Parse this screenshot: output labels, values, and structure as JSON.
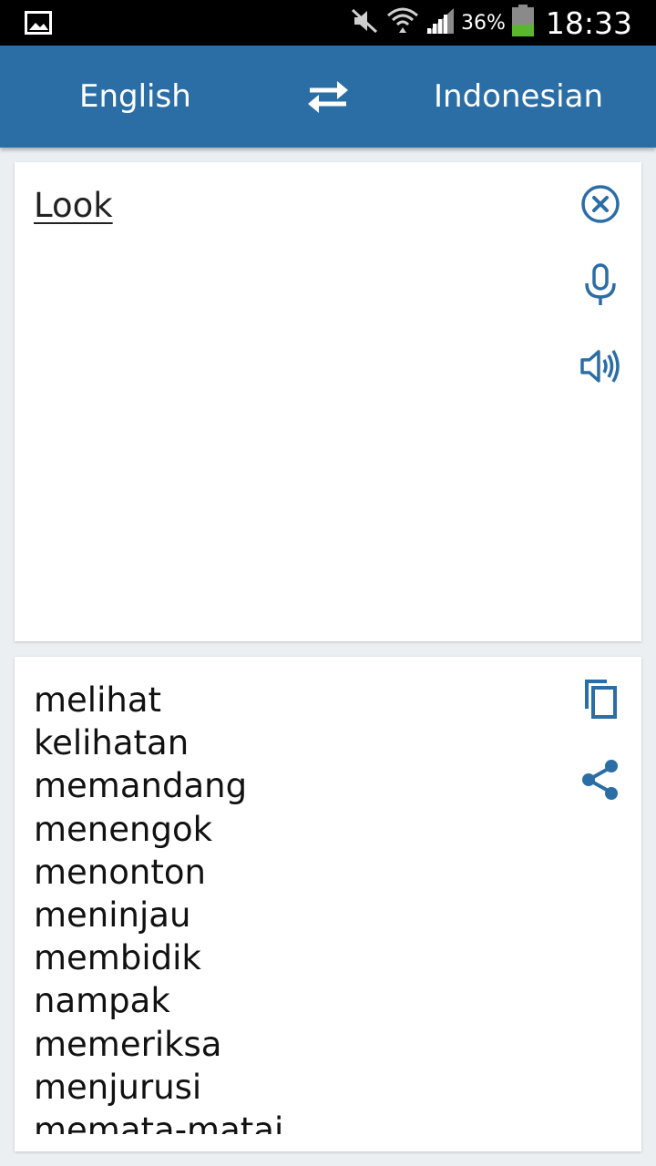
{
  "status_bar": {
    "battery": "36%",
    "time": "18:33",
    "icons": [
      "gallery-icon",
      "mute-icon",
      "wifi-icon",
      "signal-icon",
      "battery-icon"
    ]
  },
  "toolbar": {
    "source_language": "English",
    "target_language": "Indonesian",
    "swap_icon": "swap-icon"
  },
  "input": {
    "text": "Look",
    "actions": [
      "clear-icon",
      "microphone-icon",
      "speaker-icon"
    ]
  },
  "output": {
    "results": [
      "melihat",
      "kelihatan",
      "memandang",
      "menengok",
      "menonton",
      "meninjau",
      "membidik",
      "nampak",
      "memeriksa",
      "menjurusi",
      "memata-matai"
    ],
    "actions": [
      "copy-icon",
      "share-icon"
    ]
  },
  "colors": {
    "accent": "#2b6ea6",
    "icon": "#2b6ea6",
    "background": "#eceff1"
  }
}
